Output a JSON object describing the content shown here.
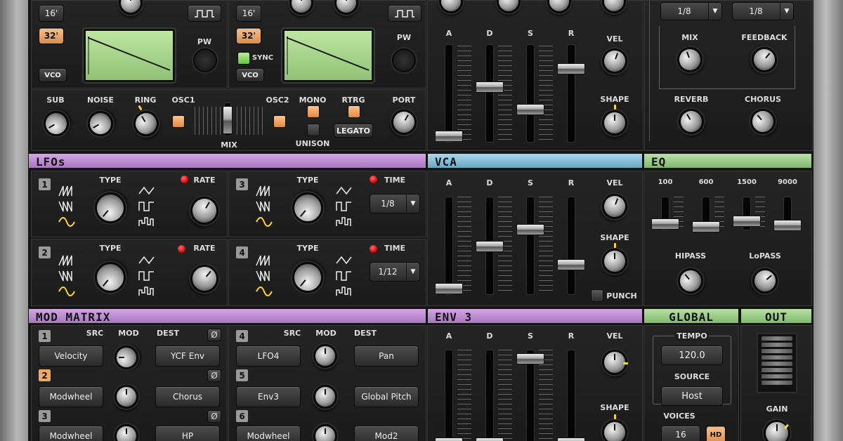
{
  "osc1": {
    "oct_16": "16'",
    "oct_32": "32'",
    "vco_label": "VCO",
    "pw_label": "PW"
  },
  "osc2": {
    "oct_16": "16'",
    "oct_32": "32'",
    "vco_label": "VCO",
    "pw_label": "PW",
    "sync_label": "SYNC"
  },
  "mixer": {
    "sub": "SUB",
    "noise": "NOISE",
    "ring": "RING",
    "osc1": "OSC1",
    "osc2": "OSC2",
    "mix": "MIX"
  },
  "voice": {
    "mono": "MONO",
    "rtrg": "RTRG",
    "unison": "UNISON",
    "legato": "LEGATO",
    "port": "PORT"
  },
  "env_top": {
    "a": "A",
    "d": "D",
    "s": "S",
    "r": "R",
    "vel": "VEL",
    "shape": "SHAPE"
  },
  "fx": {
    "delay_left": "1/8",
    "delay_right": "1/8",
    "mix": "MIX",
    "feedback": "FEEDBACK",
    "reverb": "REVERB",
    "chorus": "CHORUS"
  },
  "headers": {
    "lfos": "LFOs",
    "vca": "VCA",
    "eq": "EQ",
    "mod_matrix": "MOD MATRIX",
    "env3": "ENV 3",
    "global": "GLOBAL",
    "out": "OUT"
  },
  "lfos": [
    {
      "num": "1",
      "type": "TYPE",
      "param": "RATE"
    },
    {
      "num": "3",
      "type": "TYPE",
      "param": "TIME",
      "value": "1/8"
    },
    {
      "num": "2",
      "type": "TYPE",
      "param": "RATE"
    },
    {
      "num": "4",
      "type": "TYPE",
      "param": "TIME",
      "value": "1/12"
    }
  ],
  "vca": {
    "a": "A",
    "d": "D",
    "s": "S",
    "r": "R",
    "vel": "VEL",
    "shape": "SHAPE",
    "punch": "PUNCH"
  },
  "eq": {
    "b1": "100",
    "b2": "600",
    "b3": "1500",
    "b4": "9000",
    "hipass": "HIPASS",
    "lopass": "LoPASS"
  },
  "mod_matrix": {
    "src": "SRC",
    "mod": "MOD",
    "dest": "DEST",
    "null": "Ø",
    "slots": [
      {
        "num": "1",
        "src": "Velocity",
        "dest": "YCF Env"
      },
      {
        "num": "2",
        "src": "Modwheel",
        "dest": "Chorus"
      },
      {
        "num": "3",
        "src": "Modwheel",
        "dest": "HP"
      },
      {
        "num": "4",
        "src": "LFO4",
        "dest": "Pan"
      },
      {
        "num": "5",
        "src": "Env3",
        "dest": "Global Pitch"
      },
      {
        "num": "6",
        "src": "Modwheel",
        "dest": "Mod2"
      }
    ]
  },
  "env3": {
    "a": "A",
    "d": "D",
    "s": "S",
    "r": "R",
    "vel": "VEL",
    "shape": "SHAPE"
  },
  "global": {
    "tempo_label": "TEMPO",
    "tempo": "120.0",
    "source_label": "SOURCE",
    "source": "Host",
    "voices_label": "VOICES",
    "voices": "16",
    "hd": "HD"
  },
  "out": {
    "gain": "GAIN"
  }
}
